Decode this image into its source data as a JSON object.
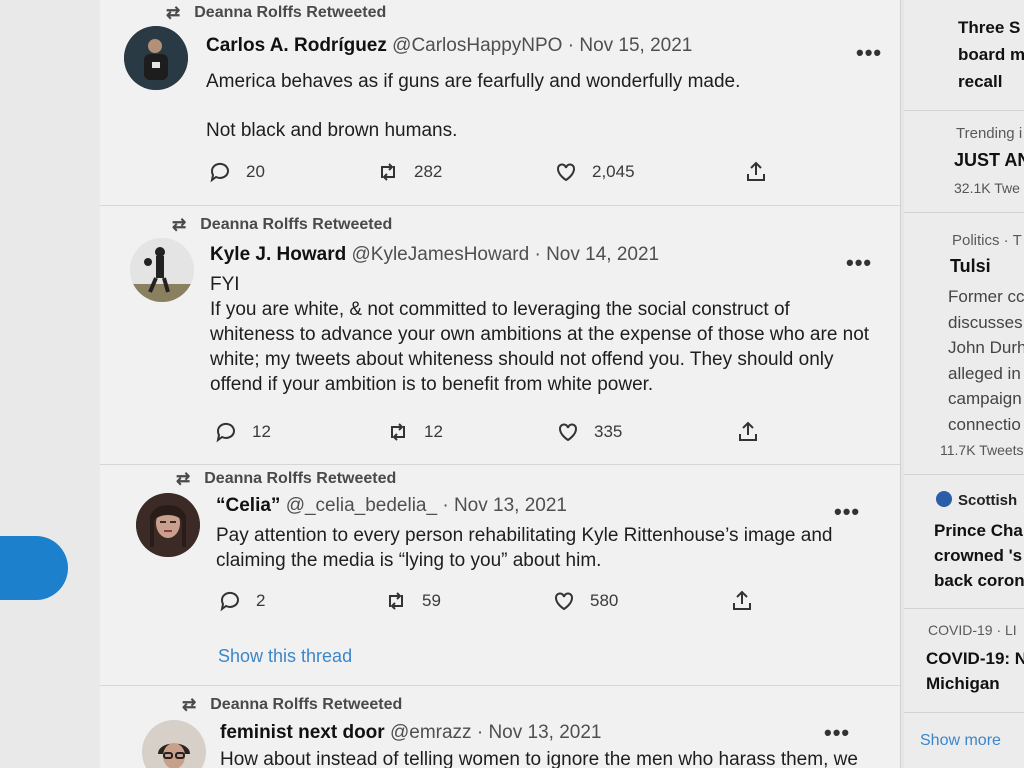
{
  "feed": {
    "tweets": [
      {
        "retweeted_by": "Deanna Rolffs Retweeted",
        "name": "Carlos A. Rodríguez",
        "handle": "@CarlosHappyNPO",
        "sep": "·",
        "date": "Nov 15, 2021",
        "text": [
          "America behaves as if guns are fearfully and wonderfully made.",
          "Not black and brown humans."
        ],
        "replies": "20",
        "retweets": "282",
        "likes": "2,045"
      },
      {
        "retweeted_by": "Deanna Rolffs Retweeted",
        "name": "Kyle J. Howard",
        "handle": "@KyleJamesHoward",
        "sep": "·",
        "date": "Nov 14, 2021",
        "text": [
          "FYI",
          "If you are white, & not committed to leveraging the social construct of whiteness to advance your own ambitions at the expense of those who are not white; my tweets about whiteness should not offend you. They should only offend if your ambition is to benefit from white power."
        ],
        "replies": "12",
        "retweets": "12",
        "likes": "335"
      },
      {
        "retweeted_by": "Deanna Rolffs Retweeted",
        "name": "“Celia”",
        "handle": "@_celia_bedelia_",
        "sep": "·",
        "date": "Nov 13, 2021",
        "text": [
          "Pay attention to every person rehabilitating Kyle Rittenhouse’s image and claiming the media is “lying to you” about him."
        ],
        "replies": "2",
        "retweets": "59",
        "likes": "580",
        "thread_link": "Show this thread"
      },
      {
        "retweeted_by": "Deanna Rolffs Retweeted",
        "name": "feminist next door",
        "handle": "@emrazz",
        "sep": "·",
        "date": "Nov 13, 2021",
        "text": [
          "How about instead of telling women to ignore the men who harass them, we"
        ]
      }
    ]
  },
  "sidebar": {
    "top_lines": [
      "Three S",
      "board m",
      "recall"
    ],
    "trend1": {
      "meta": "Trending i",
      "title": "JUST AN",
      "count": "32.1K Twe"
    },
    "trend2": {
      "meta": "Politics · T",
      "title": "Tulsi",
      "lines": [
        "Former cc",
        "discusses",
        "John Durh",
        "alleged in",
        "campaign",
        "connectio"
      ],
      "count": "11.7K Tweets"
    },
    "trend3": {
      "meta": "Scottish",
      "lines": [
        "Prince Cha",
        "crowned 's",
        "back coron"
      ]
    },
    "trend4": {
      "meta": "COVID-19 · LI",
      "lines": [
        "COVID-19: N",
        "Michigan"
      ]
    },
    "show_more": "Show more"
  },
  "colors": {
    "link": "#3b86c9",
    "accent_tab": "#1d80cc"
  }
}
